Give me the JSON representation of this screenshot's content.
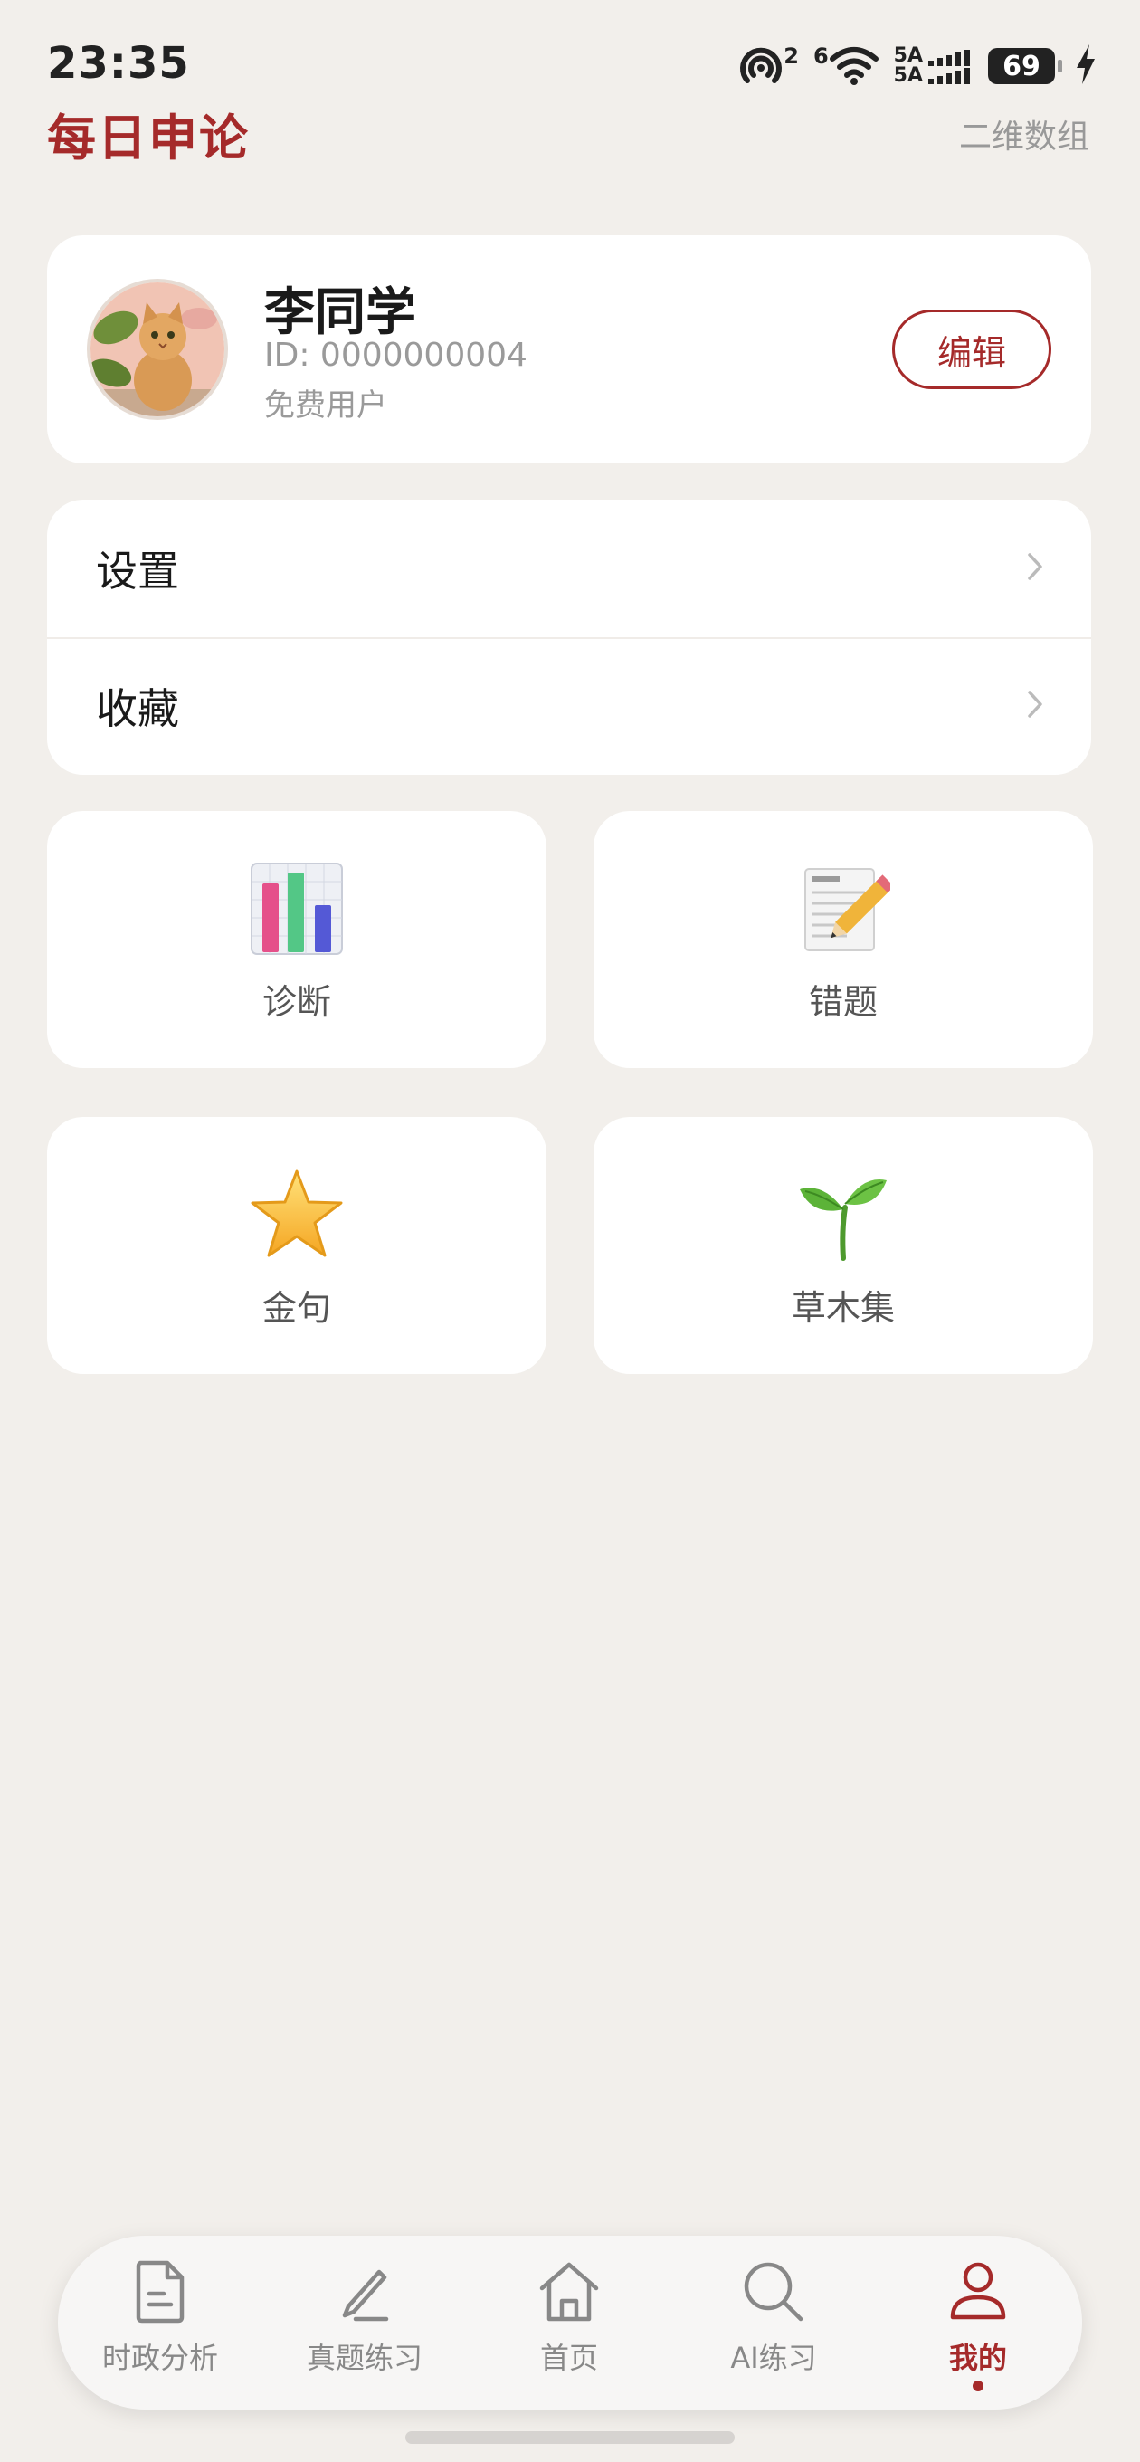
{
  "status_bar": {
    "time": "23:35",
    "hotspot_count": "2",
    "wifi_label": "6",
    "network_sim1": "5A",
    "network_sim2": "5A",
    "battery": "69",
    "icons": [
      "hotspot-icon",
      "wifi-icon",
      "signal-icon",
      "battery-icon",
      "charging-icon"
    ]
  },
  "header": {
    "title": "每日申论",
    "right_text": "二维数组"
  },
  "profile": {
    "name": "李同学",
    "id_text": "ID: 0000000004",
    "user_type": "免费用户",
    "edit_label": "编辑"
  },
  "menu": [
    {
      "label": "设置"
    },
    {
      "label": "收藏"
    }
  ],
  "tiles": [
    {
      "label": "诊断",
      "icon": "bar-chart-icon"
    },
    {
      "label": "错题",
      "icon": "memo-pencil-icon"
    },
    {
      "label": "金句",
      "icon": "star-icon"
    },
    {
      "label": "草木集",
      "icon": "seedling-icon"
    }
  ],
  "bottom_nav": [
    {
      "label": "时政分析",
      "icon": "document-icon"
    },
    {
      "label": "真题练习",
      "icon": "pen-icon"
    },
    {
      "label": "首页",
      "icon": "home-icon"
    },
    {
      "label": "AI练习",
      "icon": "search-icon"
    },
    {
      "label": "我的",
      "icon": "user-icon",
      "active": true
    }
  ],
  "colors": {
    "accent": "#a52a2a",
    "background": "#f2efeb",
    "card": "#ffffff"
  }
}
